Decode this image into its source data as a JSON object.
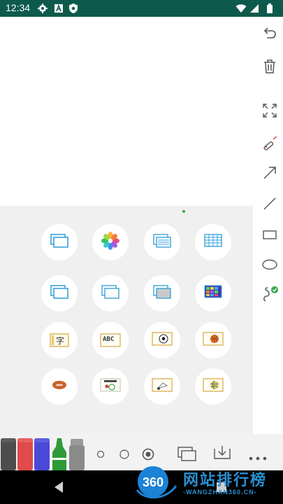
{
  "status_bar": {
    "time": "12:34",
    "icons": [
      "settings-icon",
      "text-a-icon",
      "shield-icon",
      "wifi-icon",
      "signal-icon",
      "battery-icon"
    ]
  },
  "right_toolbar": {
    "tools": [
      "undo-icon",
      "trash-icon",
      "fullscreen-icon",
      "laser-pointer-icon",
      "arrow-line-icon",
      "straight-line-icon",
      "rectangle-icon",
      "ellipse-icon",
      "freehand-lasso-icon"
    ]
  },
  "grid": {
    "row1": [
      "blank-card-icon",
      "photos-icon",
      "lined-card-icon",
      "grid-card-icon"
    ],
    "row2": [
      "blank-card-icon",
      "white-card-icon",
      "gray-card-icon",
      "color-grid-icon"
    ],
    "row3": [
      {
        "icon": "chinese-card-icon",
        "label": "字"
      },
      {
        "icon": "abc-card-icon",
        "label": "ABC"
      },
      {
        "icon": "soccer-card-icon",
        "label": ""
      },
      {
        "icon": "basketball-card-icon",
        "label": ""
      }
    ],
    "row4": [
      "football-card-icon",
      "cricket-card-icon",
      "badminton-card-icon",
      "volleyball-card-icon"
    ]
  },
  "bottom_bar": {
    "markers": [
      {
        "color": "#4d4d4d"
      },
      {
        "color": "#e04a4a"
      },
      {
        "color": "#4b49d8"
      },
      {
        "color": "#2f9a3a"
      },
      {
        "color": "#8a8a8a"
      }
    ],
    "sizes": [
      "small-dot",
      "medium-dot",
      "large-dot"
    ],
    "actions": [
      "pages-icon",
      "save-icon",
      "more-icon"
    ]
  },
  "watermark": {
    "badge": "360",
    "title": "网站排行榜",
    "subtitle": "-WANGZHAN360.CN-"
  }
}
